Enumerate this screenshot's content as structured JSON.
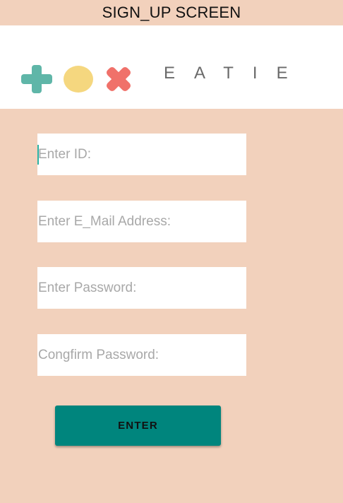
{
  "screen": {
    "title": "SIGN_UP SCREEN"
  },
  "logo": {
    "brand": "EATIE",
    "icons": [
      "plus-icon",
      "circle-icon",
      "cross-icon"
    ],
    "colors": {
      "plus": "#5fb6a8",
      "circle": "#f5d77f",
      "cross": "#f0716a"
    }
  },
  "form": {
    "id_field": {
      "placeholder": "Enter ID:",
      "value": ""
    },
    "email_field": {
      "placeholder": "Enter E_Mail Address:",
      "value": ""
    },
    "password_field": {
      "placeholder": "Enter Password:",
      "value": ""
    },
    "confirm_password_field": {
      "placeholder": "Congfirm Password:",
      "value": ""
    },
    "enter_button": {
      "label": "ENTER"
    }
  },
  "colors": {
    "background": "#f2d1bc",
    "button": "#00857d",
    "caret": "#2bb3a4"
  }
}
